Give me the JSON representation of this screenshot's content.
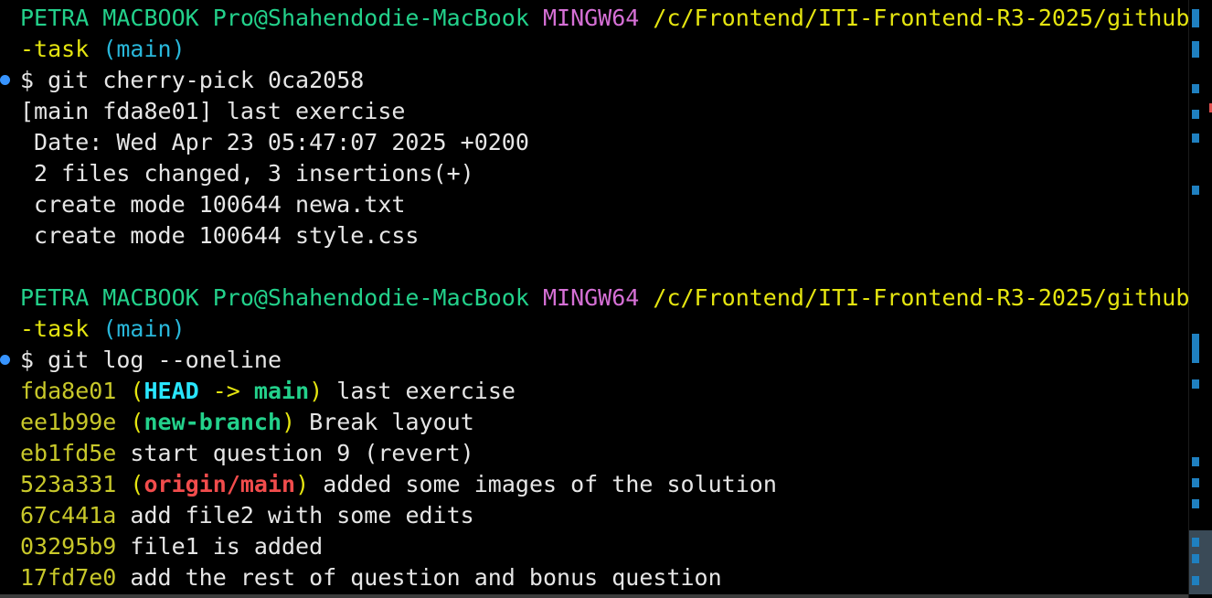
{
  "prompt": {
    "user_host": "PETRA MACBOOK Pro@Shahendodie-MacBook",
    "system": "MINGW64",
    "path": "/c/Frontend/ITI-Frontend-R3-2025/github",
    "path_cont": "-task",
    "branch": "(main)",
    "symbol": "$"
  },
  "commands": {
    "cherry_pick": "git cherry-pick 0ca2058",
    "log": "git log --oneline"
  },
  "cherry_pick_output": [
    "[main fda8e01] last exercise",
    " Date: Wed Apr 23 05:47:07 2025 +0200",
    " 2 files changed, 3 insertions(+)",
    " create mode 100644 newa.txt",
    " create mode 100644 style.css"
  ],
  "log_entries": [
    {
      "hash": "fda8e01",
      "refs_open": "(",
      "head": "HEAD",
      "arrow": " -> ",
      "ref": "main",
      "refs_close": ")",
      "message": "last exercise"
    },
    {
      "hash": "ee1b99e",
      "refs_open": "(",
      "ref": "new-branch",
      "refs_close": ")",
      "message": "Break layout"
    },
    {
      "hash": "eb1fd5e",
      "message": "start question 9 (revert)"
    },
    {
      "hash": "523a331",
      "refs_open": "(",
      "ref": "origin/main",
      "refs_close": ")",
      "message": "added some images of the solution"
    },
    {
      "hash": "67c441a",
      "message": "add file2 with some edits"
    },
    {
      "hash": "03295b9",
      "message": "file1 is added"
    },
    {
      "hash": "17fd7e0",
      "message": "add the rest of question and bonus question"
    }
  ],
  "colors": {
    "background": "#000000",
    "user_host": "#23d18b",
    "system": "#d670d6",
    "path": "#e5e510",
    "branch": "#29b8db",
    "hash": "#c8c82a",
    "head_ref": "#29e6ff",
    "origin_ref": "#f14c4c",
    "command_dot": "#3794ff"
  }
}
